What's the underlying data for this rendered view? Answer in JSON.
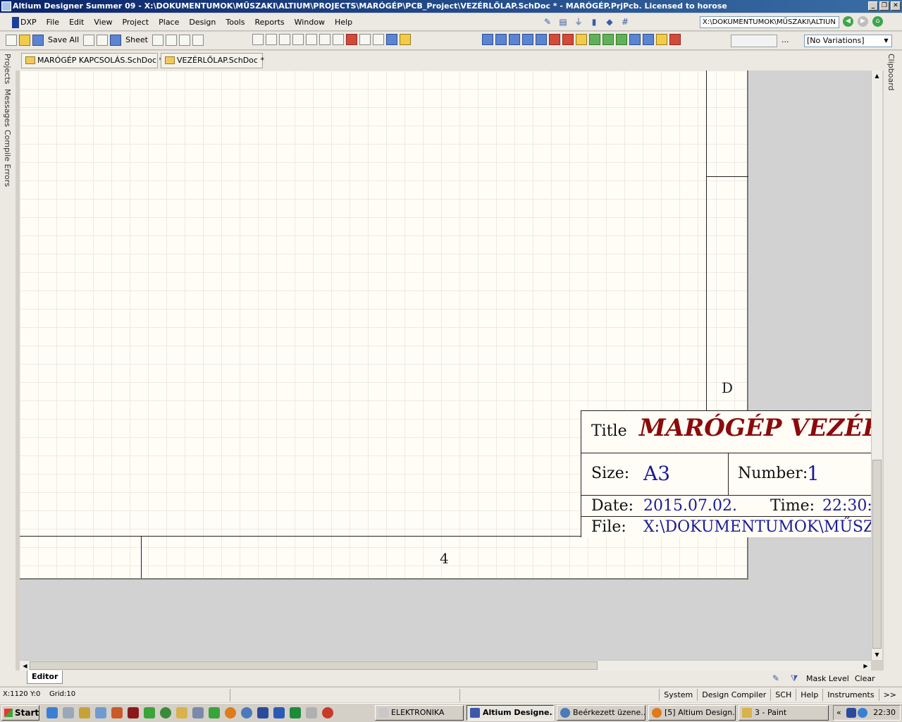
{
  "window": {
    "title": "Altium Designer Summer 09 - X:\\DOKUMENTUMOK\\MŰSZAKI\\ALTIUM\\PROJECTS\\MARÓGÉP\\PCB_Project\\VEZÉRLŐLAP.SchDoc * - MARÓGÉP.PrjPcb. Licensed to horose",
    "minimize": "_",
    "restore": "❐",
    "close": "✕"
  },
  "menu": {
    "items": [
      "DXP",
      "File",
      "Edit",
      "View",
      "Project",
      "Place",
      "Design",
      "Tools",
      "Reports",
      "Window",
      "Help"
    ]
  },
  "nav": {
    "path": "X:\\DOKUMENTUMOK\\MŰSZAKI\\ALTIUN"
  },
  "toolbar": {
    "save_all": "Save All",
    "sheet": "Sheet",
    "more": "...",
    "variations": "[No Variations]"
  },
  "left_panels": [
    "Projects",
    "Messages",
    "Compile Errors"
  ],
  "right_panels": [
    "Clipboard"
  ],
  "doc_tabs": [
    {
      "label": "MARÓGÉP KAPCSOLÁS.SchDoc *"
    },
    {
      "label": "VEZÉRLŐLAP.SchDoc *"
    }
  ],
  "sheet": {
    "zone_letter": "D",
    "zone_number": "4",
    "title_label": "Title",
    "title_value": "MARÓGÉP VEZÉR",
    "size_label": "Size:",
    "size_value": "A3",
    "number_label": "Number:",
    "number_value": "1",
    "date_label": "Date:",
    "date_value": "2015.07.02.",
    "time_label": "Time:",
    "time_value": "22:30:2",
    "file_label": "File:",
    "file_value": "X:\\DOKUMENTUMOK\\MŰSZ"
  },
  "editor": {
    "tab": "Editor",
    "mask_level": "Mask Level",
    "clear": "Clear"
  },
  "status": {
    "coords": "X:1120 Y:0",
    "grid": "Grid:10",
    "buttons": [
      "System",
      "Design Compiler",
      "SCH",
      "Help",
      "Instruments",
      ">>"
    ]
  },
  "taskbar": {
    "start": "Start",
    "tasks": [
      {
        "label": "ELEKTRONIKA",
        "active": false
      },
      {
        "label": "Altium Designe...",
        "active": true
      },
      {
        "label": "Beérkezett üzene...",
        "active": false
      },
      {
        "label": "[5] Altium Design...",
        "active": false
      },
      {
        "label": "3 - Paint",
        "active": false
      }
    ],
    "tray_arrow": "«",
    "clock": "22:30"
  },
  "colors": {
    "title_text": "#8b0a0a",
    "value_text": "#1a1a9a",
    "titlebar_start": "#0a246a",
    "titlebar_end": "#3a6ea5"
  }
}
